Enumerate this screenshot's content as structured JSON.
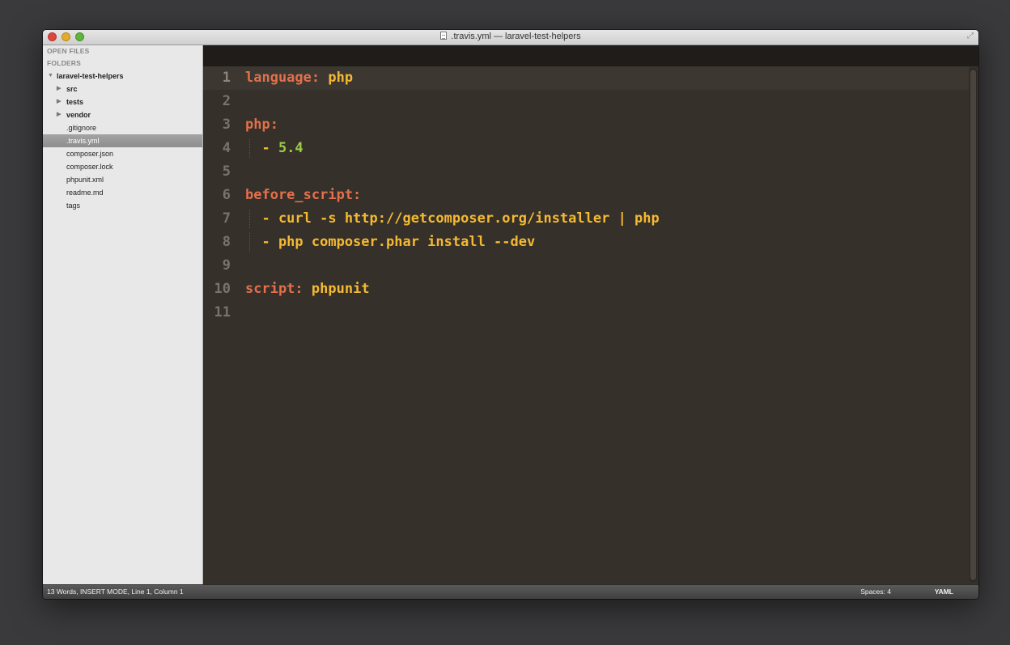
{
  "window": {
    "title": ".travis.yml — laravel-test-helpers"
  },
  "sidebar": {
    "open_files_label": "OPEN FILES",
    "folders_label": "FOLDERS",
    "root": {
      "label": "laravel-test-helpers",
      "expanded": true
    },
    "folders": [
      {
        "label": "src"
      },
      {
        "label": "tests"
      },
      {
        "label": "vendor"
      }
    ],
    "files": [
      {
        "label": ".gitignore",
        "selected": false
      },
      {
        "label": ".travis.yml",
        "selected": true
      },
      {
        "label": "composer.json",
        "selected": false
      },
      {
        "label": "composer.lock",
        "selected": false
      },
      {
        "label": "phpunit.xml",
        "selected": false
      },
      {
        "label": "readme.md",
        "selected": false
      },
      {
        "label": "tags",
        "selected": false
      }
    ]
  },
  "editor": {
    "lines": [
      {
        "n": "1",
        "tokens": [
          {
            "t": "language:",
            "c": "key"
          },
          {
            "t": " "
          },
          {
            "t": "php",
            "c": "str"
          }
        ]
      },
      {
        "n": "2",
        "tokens": []
      },
      {
        "n": "3",
        "tokens": [
          {
            "t": "php:",
            "c": "key"
          }
        ]
      },
      {
        "n": "4",
        "tokens": [
          {
            "t": "  - ",
            "c": "str"
          },
          {
            "t": "5.4",
            "c": "num"
          }
        ]
      },
      {
        "n": "5",
        "tokens": []
      },
      {
        "n": "6",
        "tokens": [
          {
            "t": "before_script:",
            "c": "key"
          }
        ]
      },
      {
        "n": "7",
        "tokens": [
          {
            "t": "  - curl -s http://getcomposer.org/installer | php",
            "c": "str"
          }
        ]
      },
      {
        "n": "8",
        "tokens": [
          {
            "t": "  - php composer.phar install --dev",
            "c": "str"
          }
        ]
      },
      {
        "n": "9",
        "tokens": []
      },
      {
        "n": "10",
        "tokens": [
          {
            "t": "script:",
            "c": "key"
          },
          {
            "t": " "
          },
          {
            "t": "phpunit",
            "c": "str"
          }
        ]
      },
      {
        "n": "11",
        "tokens": []
      }
    ],
    "active_line": 1
  },
  "status": {
    "left": "13 Words, INSERT MODE, Line 1, Column 1",
    "spaces": "Spaces: 4",
    "syntax": "YAML"
  },
  "colors": {
    "key": "#e4704b",
    "string": "#f4b932",
    "number": "#9ccc45",
    "background": "#35302a"
  }
}
